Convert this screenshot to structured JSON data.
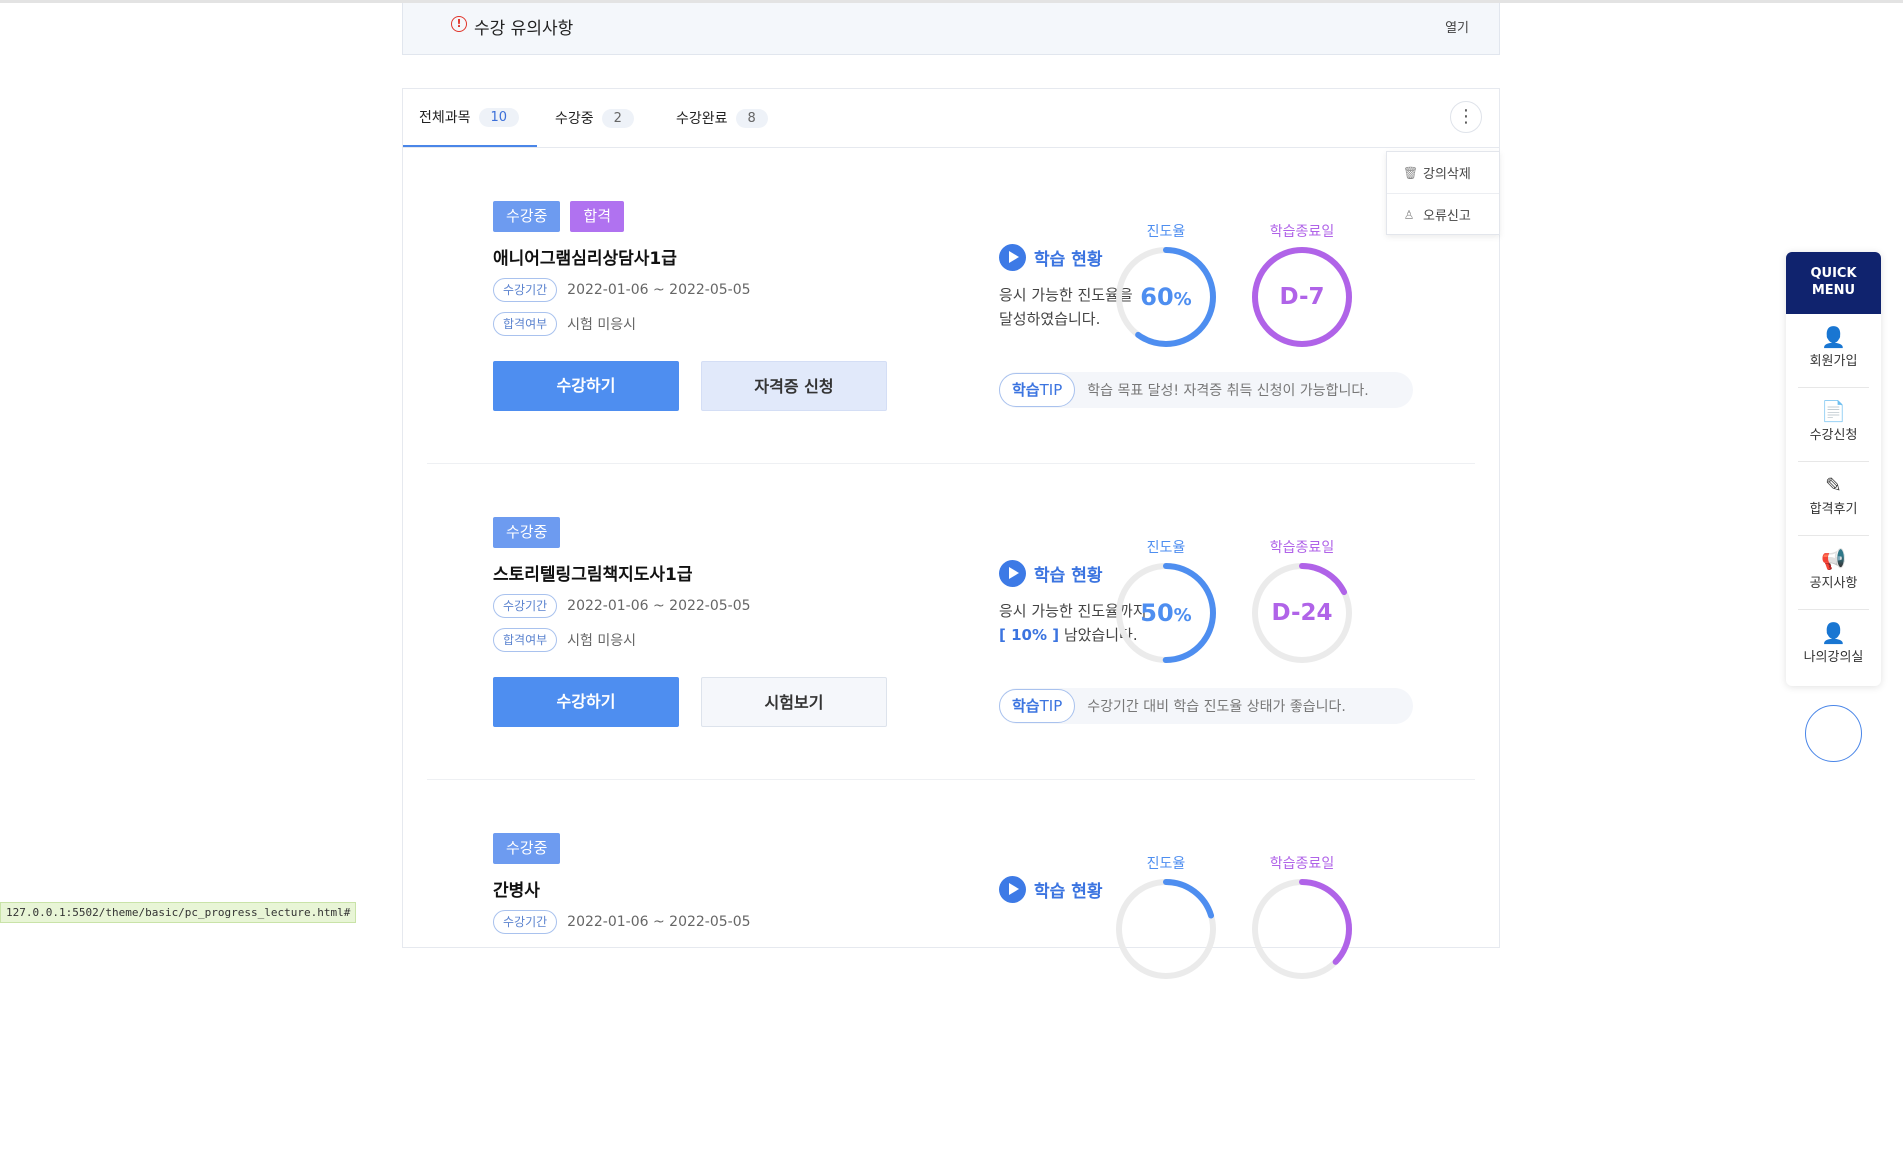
{
  "notice": {
    "title": "수강 유의사항",
    "open_label": "열기"
  },
  "tabs": [
    {
      "label": "전체과목",
      "count": "10"
    },
    {
      "label": "수강중",
      "count": "2"
    },
    {
      "label": "수강완료",
      "count": "8"
    }
  ],
  "dropdown": {
    "delete_label": "강의삭제",
    "report_label": "오류신고"
  },
  "common": {
    "period_chip": "수강기간",
    "result_chip": "합격여부",
    "status_title": "학습 현황",
    "progress_label": "진도율",
    "end_label": "학습종료일",
    "tip_bold": "학습",
    "tip_rest": "TIP",
    "study_button": "수강하기"
  },
  "courses": [
    {
      "badges": [
        "수강중",
        "합격"
      ],
      "title": "애니어그램심리상담사1급",
      "period": "2022-01-06 ~ 2022-05-05",
      "result": "시험 미응시",
      "secondary_button": "자격증 신청",
      "msg_line1": "응시 가능한 진도율을",
      "msg_line2": "달성하였습니다.",
      "progress": "60",
      "progress_unit": "%",
      "dday": "D-7",
      "tip": "학습 목표 달성! 자격증 취득 신청이 가능합니다."
    },
    {
      "badges": [
        "수강중"
      ],
      "title": "스토리텔링그림책지도사1급",
      "period": "2022-01-06 ~ 2022-05-05",
      "result": "시험 미응시",
      "secondary_button": "시험보기",
      "msg_line1": "응시 가능한 진도율까지",
      "msg_hl": "[ 10% ]",
      "msg_line2": " 남았습니다.",
      "progress": "50",
      "progress_unit": "%",
      "dday": "D-24",
      "tip": "수강기간 대비 학습 진도율 상태가 좋습니다."
    },
    {
      "badges": [
        "수강중"
      ],
      "title": "간병사",
      "period": "2022-01-06 ~ 2022-05-05"
    }
  ],
  "quick_menu": {
    "title_line1": "QUICK",
    "title_line2": "MENU",
    "items": [
      {
        "label": "회원가입",
        "icon": "user-plus-icon"
      },
      {
        "label": "수강신청",
        "icon": "document-search-icon"
      },
      {
        "label": "합격후기",
        "icon": "pencil-icon"
      },
      {
        "label": "공지사항",
        "icon": "megaphone-icon"
      },
      {
        "label": "나의강의실",
        "icon": "my-user-icon"
      }
    ]
  },
  "status_url": "127.0.0.1:5502/theme/basic/pc_progress_lecture.html#",
  "colors": {
    "accent": "#4e8ef0",
    "purple": "#b063e8",
    "navy": "#10236e"
  }
}
